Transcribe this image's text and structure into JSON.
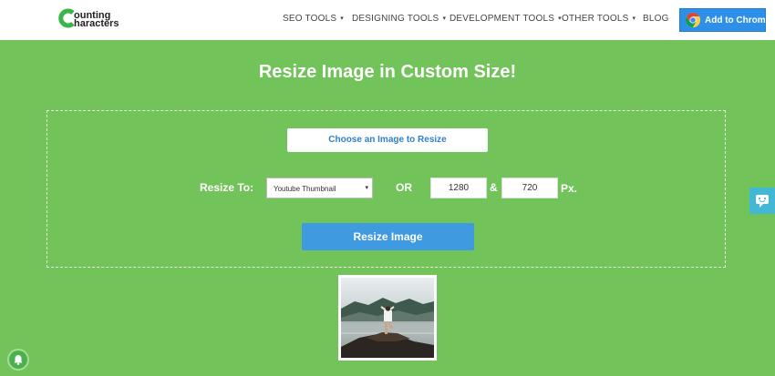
{
  "header": {
    "logo": {
      "line1": "ounting",
      "line2": "haracters"
    },
    "nav": [
      {
        "label": "SEO TOOLS",
        "has_dropdown": true
      },
      {
        "label": "DESIGNING TOOLS",
        "has_dropdown": true
      },
      {
        "label": "DEVELOPMENT TOOLS",
        "has_dropdown": true
      },
      {
        "label": "OTHER TOOLS",
        "has_dropdown": true
      },
      {
        "label": "BLOG",
        "has_dropdown": false
      }
    ],
    "caret": "▾",
    "chrome_button": {
      "label": "Add to Chrome",
      "icon": "chrome-icon"
    }
  },
  "main": {
    "title": "Resize Image in Custom Size!",
    "choose_button": "Choose an Image to Resize",
    "resize_to_label": "Resize To:",
    "preset_select": {
      "value": "Youtube Thumbnail",
      "arrow": "▾"
    },
    "or_label": "OR",
    "width_value": "1280",
    "amp": "&",
    "height_value": "720",
    "unit": "Px.",
    "resize_button": "Resize Image"
  },
  "preview": {
    "icon": "image-preview"
  },
  "side": {
    "chat_icon": "chat-icon",
    "bell_icon": "bell-icon"
  },
  "colors": {
    "background": "#72c35a",
    "primary_button": "#3f9ae0",
    "chrome_button": "#2d8fe8",
    "chat_tab": "#42b8d4"
  }
}
